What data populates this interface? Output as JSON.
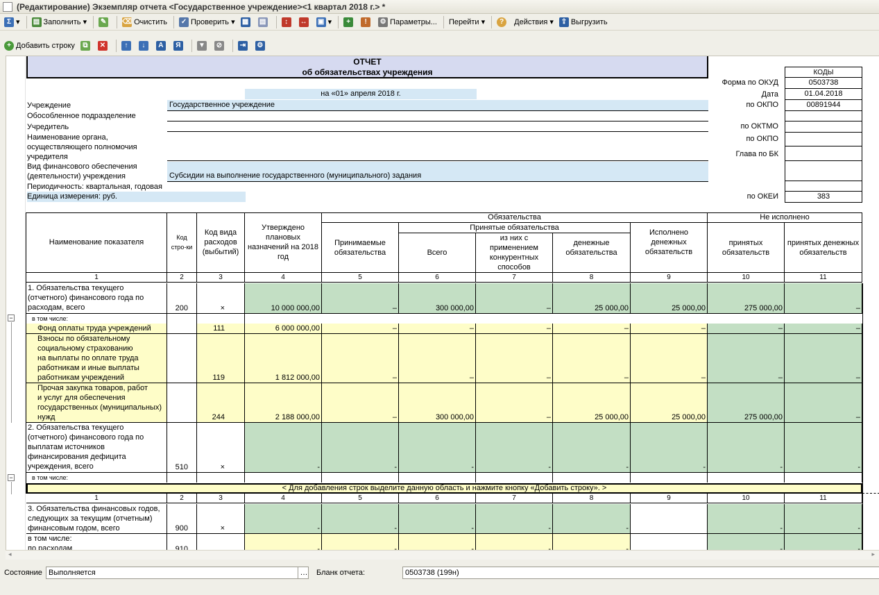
{
  "window": {
    "title": "(Редактирование) Экземпляр отчета <Государственное учреждение><1 квартал 2018 г.> *"
  },
  "toolbar1": {
    "fill": "Заполнить",
    "clear": "Очистить",
    "check": "Проверить",
    "params": "Параметры...",
    "goto": "Перейти",
    "actions": "Действия",
    "export": "Выгрузить"
  },
  "toolbar2": {
    "add_row": "Добавить строку"
  },
  "report": {
    "title": "ОТЧЕТ",
    "subtitle": "об обязательствах учреждения",
    "date_line": "на «01» апреля 2018 г.",
    "labels": {
      "institution": "Учреждение",
      "subdivision": "Обособленное подразделение",
      "founder": "Учредитель",
      "authority": "Наименование органа,\nосуществляющего полномочия\nучредителя",
      "finance_type": "Вид финансового обеспечения\n(деятельности) учреждения",
      "periodicity": "Периодичность: квартальная, годовая",
      "unit": "Единица измерения: руб."
    },
    "values": {
      "institution": "Государственное учреждение",
      "finance_type": "Субсидии на выполнение государственного (муниципального) задания"
    },
    "codes": {
      "header": "КОДЫ",
      "okud_label": "Форма по ОКУД",
      "okud": "0503738",
      "date_label": "Дата",
      "date": "01.04.2018",
      "okpo_label": "по ОКПО",
      "okpo": "00891944",
      "oktmo_label": "по ОКТМО",
      "okpo2_label": "по ОКПО",
      "glava_label": "Глава по БК",
      "okei_label": "по ОКЕИ",
      "okei": "383"
    }
  },
  "table": {
    "headers": {
      "name": "Наименование показателя",
      "code": "Код стро-ки",
      "exp": "Код вида расходов (выбытий)",
      "approved": "Утверждено плановых назначений на 2018 год",
      "obligations": "Обязательства",
      "accepted_obl": "Принимаемые обязательства",
      "taken": "Принятые обязательства",
      "total": "Всего",
      "competitive": "из них с применением конкурентных способов",
      "money": "денежные обязательства",
      "executed": "Исполнено денежных обязательств",
      "not_done": "Не исполнено",
      "nd_taken": "принятых обязательств",
      "nd_money": "принятых денежных обязательств"
    },
    "colnums": [
      "1",
      "2",
      "3",
      "4",
      "5",
      "6",
      "7",
      "8",
      "9",
      "10",
      "11"
    ],
    "rows": [
      {
        "name": "1. Обязательства текущего\n(отчетного) финансового года по\nрасходам, всего",
        "code": "200",
        "exp": "×",
        "v": [
          "10 000 000,00",
          "–",
          "300 000,00",
          "–",
          "25 000,00",
          "25 000,00",
          "275 000,00",
          "–"
        ]
      },
      {
        "name": "в том числе:"
      },
      {
        "name": "Фонд оплаты труда учреждений",
        "code": "",
        "exp": "111",
        "v": [
          "6 000 000,00",
          "–",
          "–",
          "–",
          "–",
          "–",
          "–",
          "–"
        ]
      },
      {
        "name": "Взносы по обязательному\nсоциальному страхованию\nна выплаты по оплате труда\nработникам и иные выплаты\nработникам учреждений",
        "code": "",
        "exp": "119",
        "v": [
          "1 812 000,00",
          "–",
          "–",
          "–",
          "–",
          "–",
          "–",
          "–"
        ]
      },
      {
        "name": "Прочая закупка товаров, работ\nи услуг для обеспечения\nгосударственных (муниципальных)\nнужд",
        "code": "",
        "exp": "244",
        "v": [
          "2 188 000,00",
          "–",
          "300 000,00",
          "–",
          "25 000,00",
          "25 000,00",
          "275 000,00",
          "–"
        ]
      },
      {
        "name": "2. Обязательства текущего\n(отчетного) финансового года по\nвыплатам источников\nфинансирования дефицита\nучреждения, всего",
        "code": "510",
        "exp": "×",
        "v": [
          "-",
          "-",
          "-",
          "-",
          "-",
          "-",
          "-",
          "-"
        ]
      },
      {
        "name": "в том числе:"
      },
      {
        "name": "3. Обязательства финансовых годов,\nследующих за текущим (отчетным)\nфинансовым годом, всего",
        "code": "900",
        "exp": "×",
        "v": [
          "-",
          "-",
          "-",
          "-",
          "-",
          "",
          "-",
          "-"
        ]
      },
      {
        "name": "в том числе:\nпо расходам",
        "code": "910",
        "exp": "",
        "v": [
          "-",
          "-",
          "-",
          "-",
          "-",
          "",
          "-",
          "-"
        ]
      }
    ],
    "add_hint": "< Для добавления строк выделите данную область и нажмите кнопку «Добавить строку». >"
  },
  "status": {
    "state_label": "Состояние",
    "state_value": "Выполняется",
    "blank_label": "Бланк отчета:",
    "blank_value": "0503738 (199н)"
  }
}
